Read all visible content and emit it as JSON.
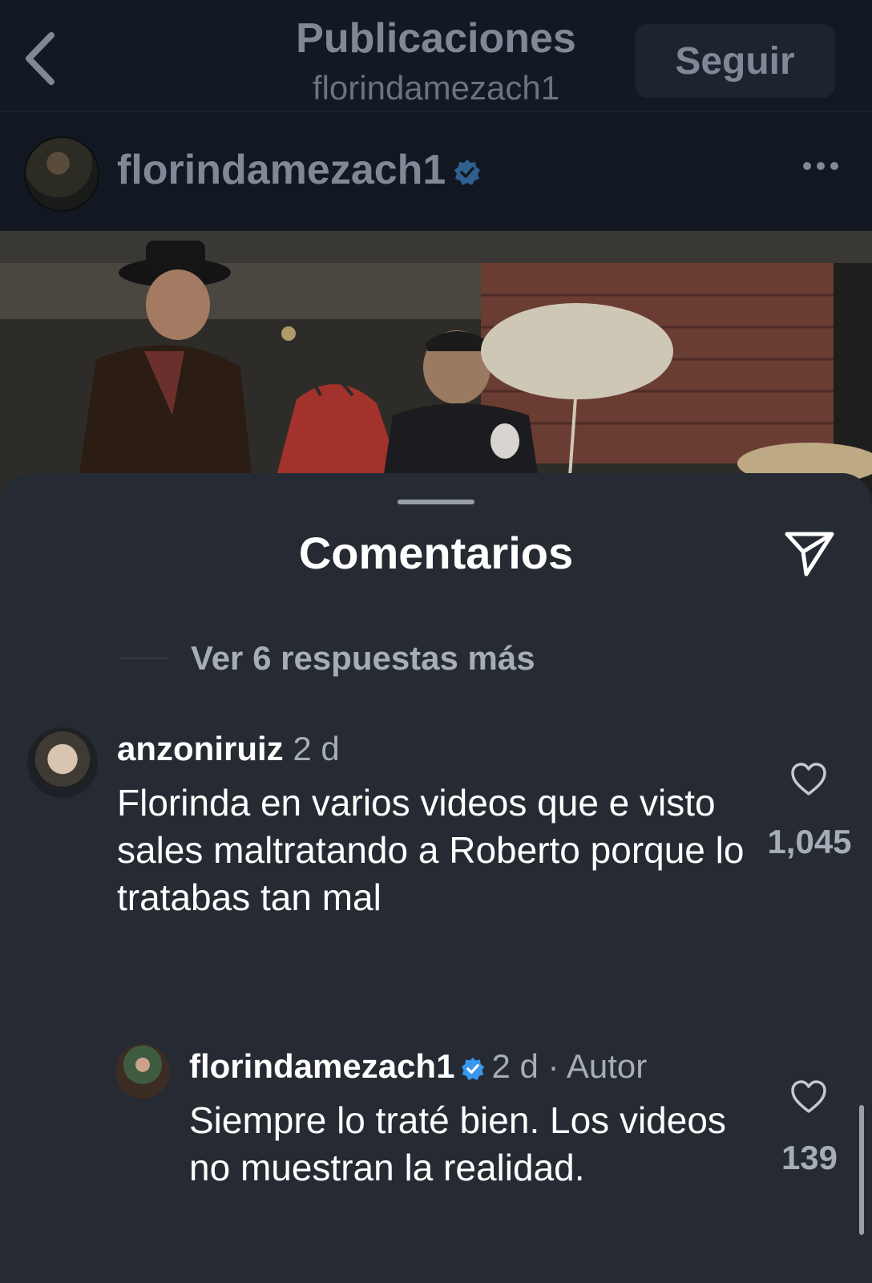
{
  "header": {
    "title": "Publicaciones",
    "subtitle": "florindamezach1",
    "follow_label": "Seguir",
    "back_icon": "chevron-left-icon"
  },
  "post": {
    "username": "florindamezach1",
    "verified_icon": "verified-badge-icon",
    "more_icon": "more-horizontal-icon"
  },
  "comments_sheet": {
    "title": "Comentarios",
    "share_icon": "send-icon",
    "view_more_replies": "Ver 6 respuestas más"
  },
  "comments": [
    {
      "username": "anzoniruiz",
      "time": "2 d",
      "text": "Florinda en varios videos que e visto sales maltratando a Roberto porque lo tratabas tan mal",
      "likes": "1,045"
    },
    {
      "username": "florindamezach1",
      "time": "2 d · Autor",
      "text": "Siempre lo traté bien. Los videos no muestran la realidad.",
      "likes": "139"
    }
  ],
  "colors": {
    "sheet_background": "#262b33",
    "page_background": "#0f141b",
    "verified_blue": "#3897f0"
  }
}
